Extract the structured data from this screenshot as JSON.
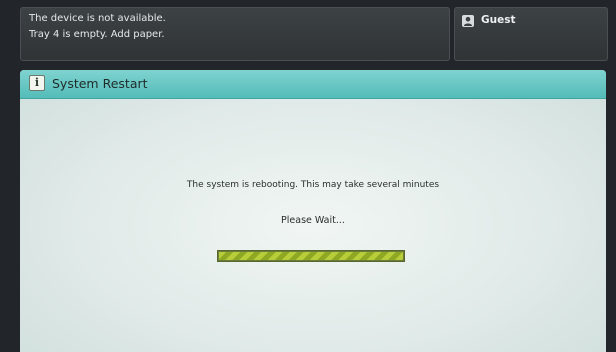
{
  "status": {
    "line1": "The device is not available.",
    "line2": "Tray 4 is empty.  Add paper."
  },
  "user": {
    "icon": "user-icon",
    "label": "Guest"
  },
  "dialog": {
    "icon": "info-icon",
    "icon_glyph": "i",
    "title": "System Restart",
    "message": "The system is rebooting. This may take several minutes",
    "wait_text": "Please Wait...",
    "progress_fraction": 1.0
  },
  "colors": {
    "header": "#54bcb8",
    "progress_fill": "#b8cd3a"
  }
}
